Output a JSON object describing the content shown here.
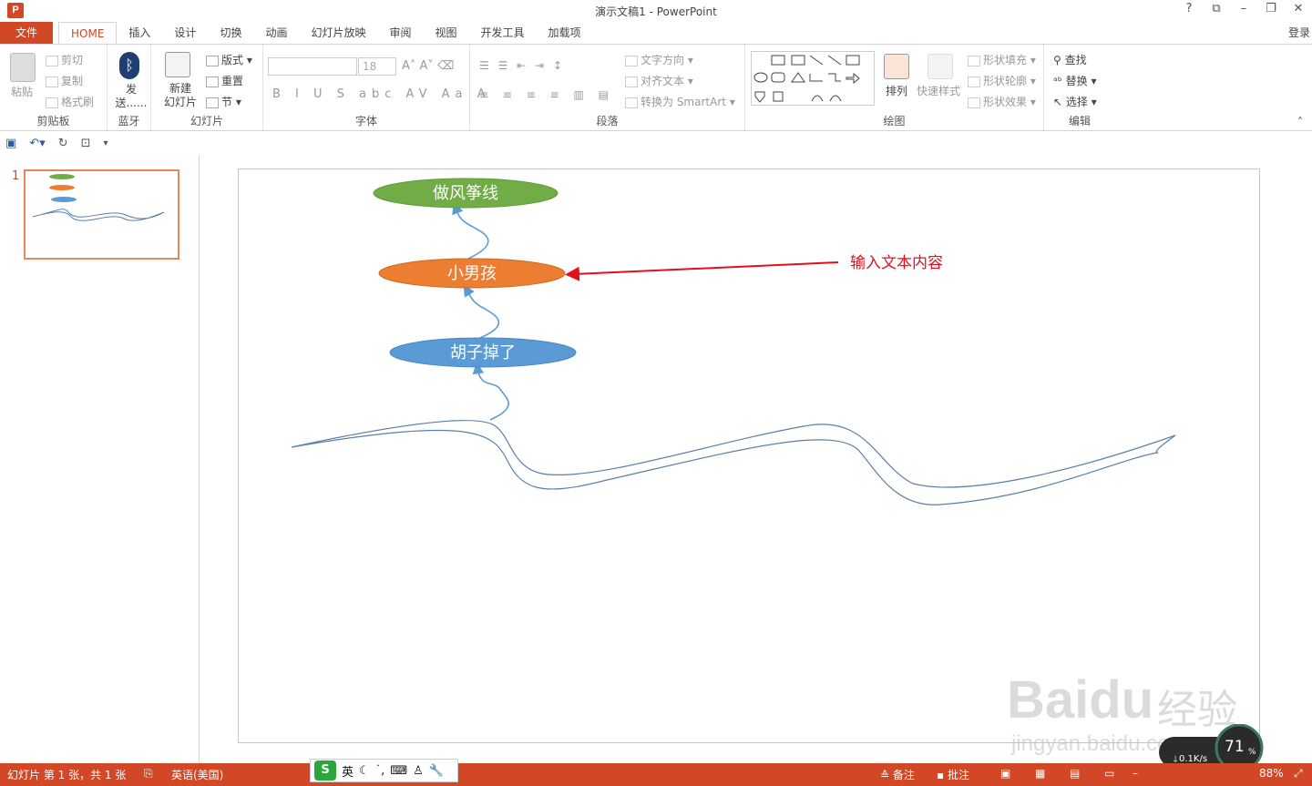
{
  "window": {
    "title": "演示文稿1 - PowerPoint",
    "app_icon": "P",
    "login": "登录",
    "controls": [
      "?",
      "⧉",
      "–",
      "❐",
      "✕"
    ]
  },
  "tabs": [
    "文件",
    "HOME",
    "插入",
    "设计",
    "切换",
    "动画",
    "幻灯片放映",
    "审阅",
    "视图",
    "开发工具",
    "加载项"
  ],
  "ribbon": {
    "clipboard": {
      "label": "剪贴板",
      "paste": "粘贴",
      "cut": "剪切",
      "copy": "复制",
      "format_painter": "格式刷"
    },
    "bluetooth": {
      "label": "蓝牙",
      "send": "发送......"
    },
    "slides": {
      "label": "幻灯片",
      "new_slide": "新建\n幻灯片",
      "layout": "版式",
      "reset": "重置",
      "section": "节"
    },
    "font": {
      "label": "字体",
      "font_name": "",
      "font_size": "18"
    },
    "paragraph": {
      "label": "段落",
      "text_direction": "文字方向",
      "align_text": "对齐文本",
      "smartart": "转换为 SmartArt"
    },
    "drawing": {
      "label": "绘图",
      "arrange": "排列",
      "quick_styles": "快速样式",
      "shape_fill": "形状填充",
      "shape_outline": "形状轮廓",
      "shape_effects": "形状效果"
    },
    "editing": {
      "label": "编辑",
      "find": "查找",
      "replace": "替换",
      "select": "选择"
    }
  },
  "slide_panel": {
    "slide_number": "1"
  },
  "slide": {
    "ovals": [
      {
        "text": "做风筝线",
        "color": "#70ad47"
      },
      {
        "text": "小男孩",
        "color": "#ed7d31"
      },
      {
        "text": "胡子掉了",
        "color": "#5b9bd5"
      }
    ],
    "annotation": {
      "text": "输入文本内容",
      "color": "#e3101b"
    }
  },
  "status": {
    "slide_info": "幻灯片 第 1 张，共 1 张",
    "language": "英语(美国)",
    "notes": "备注",
    "comments": "批注",
    "zoom": "88%"
  },
  "ime": {
    "logo": "S",
    "mode": "英"
  },
  "network": {
    "speed": "0.1K/s",
    "percent": "71",
    "percent_sign": "%"
  },
  "watermark": {
    "brand": "Baidu",
    "brand_cn": "经验",
    "url": "jingyan.baidu.com"
  }
}
